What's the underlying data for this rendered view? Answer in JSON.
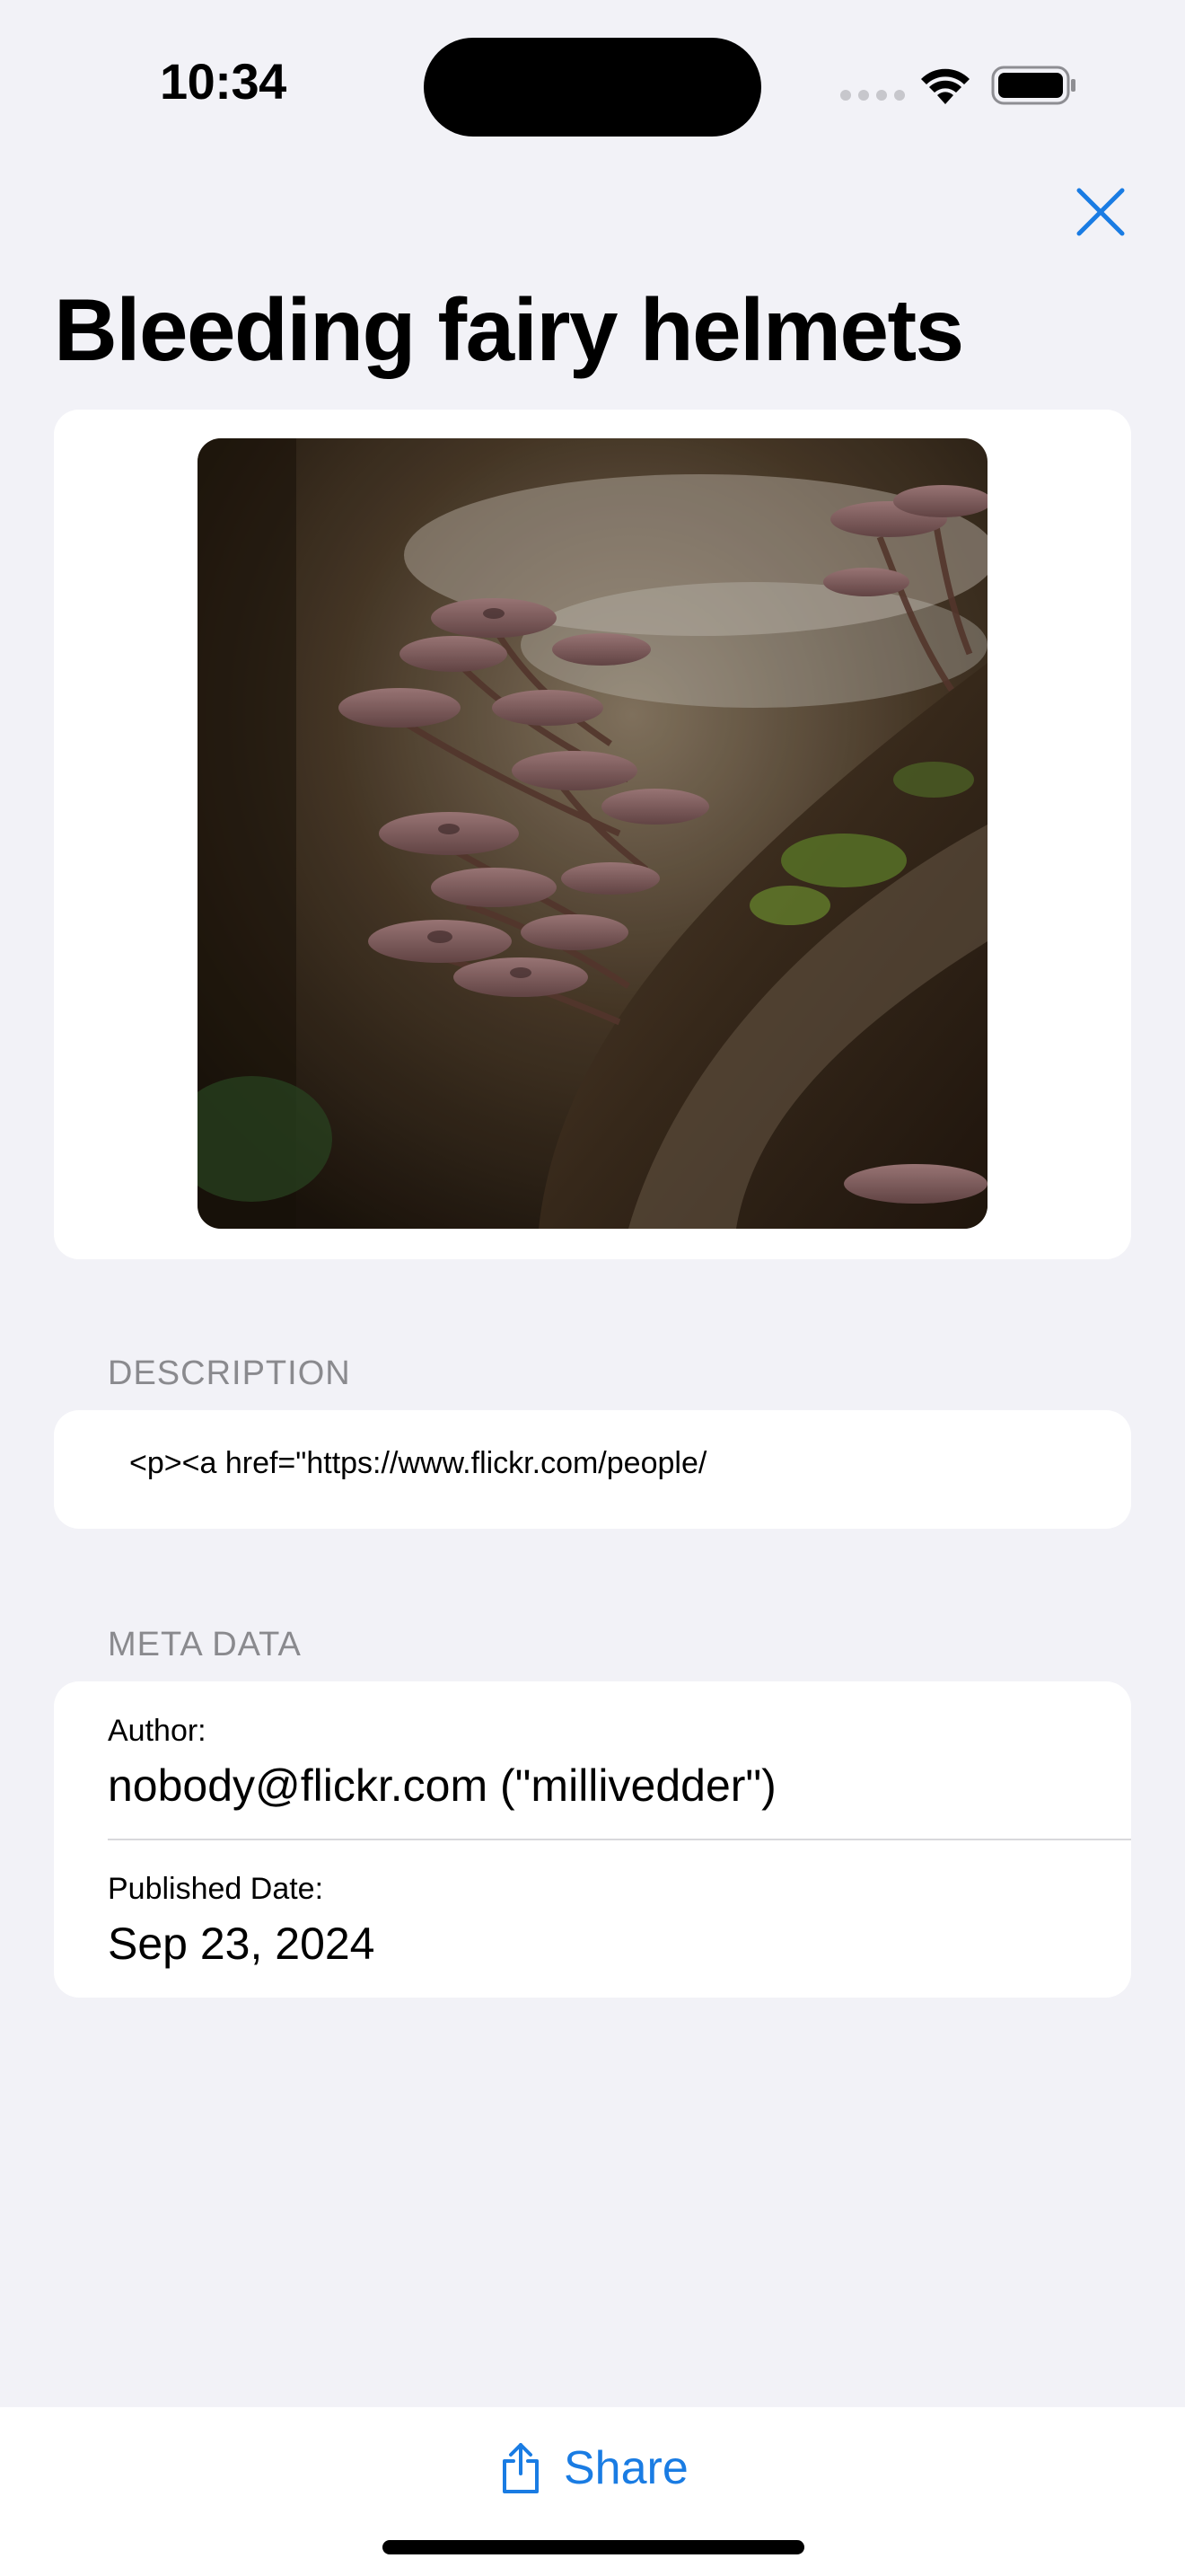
{
  "status_bar": {
    "time": "10:34",
    "icons": [
      "cellular-signal-icon",
      "wifi-icon",
      "battery-icon"
    ]
  },
  "header": {
    "close_icon": "close-icon",
    "title": "Bleeding fairy helmets"
  },
  "photo": {
    "subject": "mushroom-photo"
  },
  "description_section": {
    "header": "DESCRIPTION",
    "text": "<p><a href=\"https://www.flickr.com/people/"
  },
  "meta_section": {
    "header": "META DATA",
    "author_label": "Author:",
    "author_value": "nobody@flickr.com (\"millivedder\")",
    "published_label": "Published Date:",
    "published_value": "Sep 23, 2024"
  },
  "toolbar": {
    "share_icon": "share-icon",
    "share_label": "Share"
  },
  "colors": {
    "background": "#f2f2f7",
    "card": "#ffffff",
    "accent": "#1a7ce3",
    "secondary_text": "#8a8a8e"
  }
}
